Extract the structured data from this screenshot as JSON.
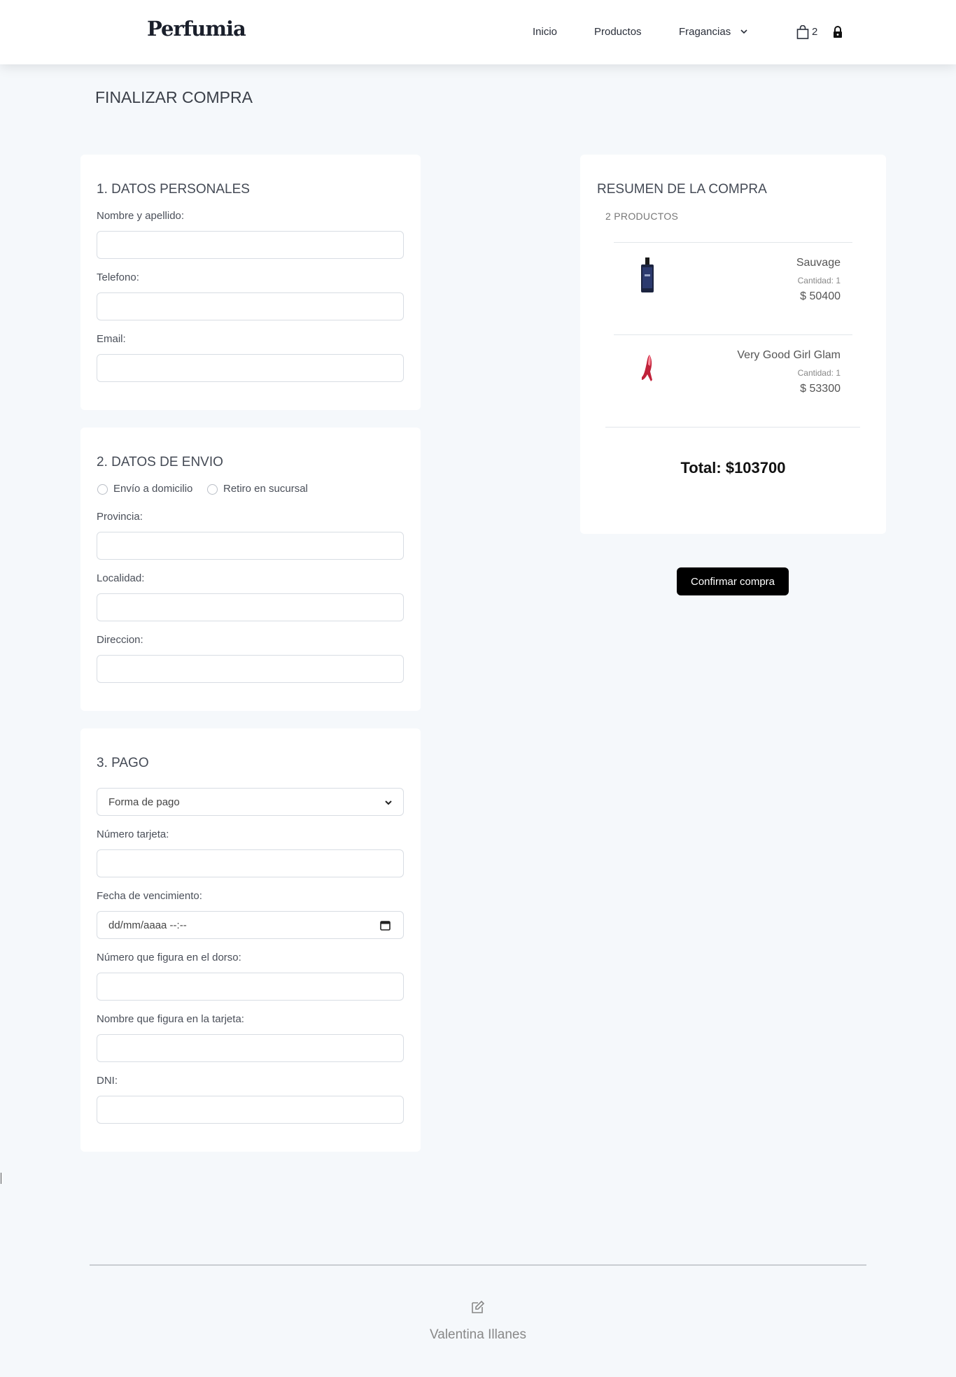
{
  "nav": {
    "brand": "Perfumia",
    "links": [
      {
        "label": "Inicio"
      },
      {
        "label": "Productos"
      },
      {
        "label": "Fragancias"
      }
    ],
    "cart_count": "2"
  },
  "page_title": "FINALIZAR COMPRA",
  "personal": {
    "heading": "1. DATOS PERSONALES",
    "name_label": "Nombre y apellido:",
    "phone_label": "Telefono:",
    "email_label": "Email:"
  },
  "shipping": {
    "heading": "2. DATOS DE ENVIO",
    "option_home": "Envío a domicilio",
    "option_branch": "Retiro en sucursal",
    "province_label": "Provincia:",
    "city_label": "Localidad:",
    "address_label": "Direccion:"
  },
  "payment": {
    "heading": "3. PAGO",
    "method_placeholder": "Forma de pago",
    "card_number_label": "Número tarjeta:",
    "expiry_label": "Fecha de vencimiento:",
    "expiry_value": "dd/mm/aaaa --:--",
    "cvv_label": "Número que figura en el dorso:",
    "card_name_label": "Nombre que figura en la tarjeta:",
    "dni_label": "DNI:"
  },
  "summary": {
    "heading": "RESUMEN DE LA COMPRA",
    "count": "2 PRODUCTOS",
    "items": [
      {
        "name": "Sauvage",
        "qty": "Cantidad: 1",
        "price": "$ 50400",
        "image": "perfume-bottle-dark-blue"
      },
      {
        "name": "Very Good Girl Glam",
        "qty": "Cantidad: 1",
        "price": "$ 53300",
        "image": "perfume-bottle-red-heel"
      }
    ],
    "total": "Total: $103700",
    "confirm_label": "Confirmar compra"
  },
  "footer": {
    "author": "Valentina Illanes",
    "icon": "edit-icon"
  },
  "colors": {
    "background": "#f5f8fb",
    "button": "#000000",
    "card": "#ffffff"
  }
}
